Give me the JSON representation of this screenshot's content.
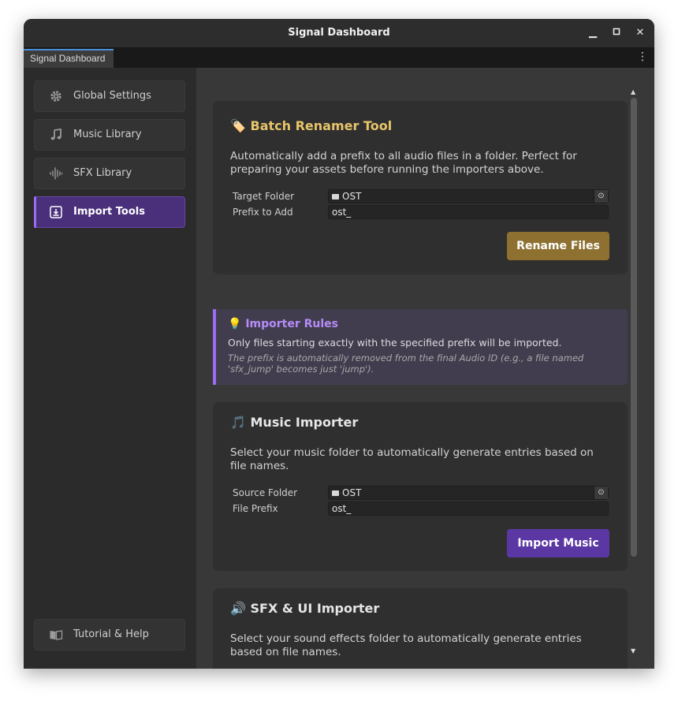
{
  "window": {
    "title": "Signal Dashboard",
    "minimize": "▁",
    "maximize": "▢",
    "close": "✕"
  },
  "tab": {
    "label": "Signal Dashboard",
    "menu": "⋮"
  },
  "sidebar": {
    "items": [
      {
        "label": "Global Settings",
        "icon": "gear-icon"
      },
      {
        "label": "Music Library",
        "icon": "music-note-icon"
      },
      {
        "label": "SFX Library",
        "icon": "waveform-icon"
      },
      {
        "label": "Import Tools",
        "icon": "import-icon",
        "active": true
      }
    ],
    "footer": {
      "label": "Tutorial & Help",
      "icon": "book-icon"
    }
  },
  "batch_renamer": {
    "emoji": "🏷️",
    "title": "Batch Renamer Tool",
    "description": "Automatically add a prefix to all audio files in a folder. Perfect for preparing your assets before running the importers above.",
    "target_folder_label": "Target Folder",
    "target_folder_value": "OST",
    "prefix_label": "Prefix to Add",
    "prefix_value": "ost_",
    "button": "Rename Files"
  },
  "rules": {
    "emoji": "💡",
    "title": "Importer Rules",
    "line1": "Only files starting exactly with the specified prefix will be imported.",
    "line2": "The prefix is automatically removed from the final Audio ID (e.g., a file named 'sfx_jump' becomes just 'jump')."
  },
  "music_importer": {
    "emoji": "🎵",
    "title": "Music Importer",
    "description": "Select your music folder to automatically generate entries based on file names.",
    "source_folder_label": "Source Folder",
    "source_folder_value": "OST",
    "prefix_label": "File Prefix",
    "prefix_value": "ost_",
    "button": "Import Music"
  },
  "sfx_importer": {
    "emoji": "🔊",
    "title": "SFX & UI Importer",
    "description": "Select your sound effects folder to automatically generate entries based on file names."
  },
  "colors": {
    "accent_purple": "#9b6cf0",
    "button_gold": "#8e7131",
    "button_purple": "#5b37a3",
    "title_gold": "#e8c46a"
  }
}
